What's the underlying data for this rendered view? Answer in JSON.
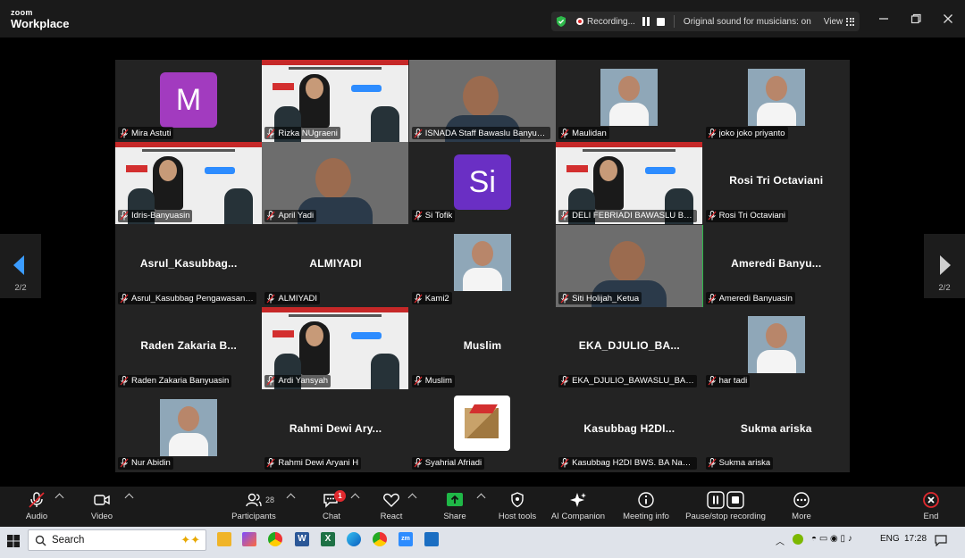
{
  "app": {
    "logo_line1": "zoom",
    "logo_line2": "Workplace"
  },
  "recording": {
    "status": "Recording...",
    "original_sound": "Original sound for musicians: on",
    "view_label": "View"
  },
  "participants": [
    {
      "label": "Mira Astuti",
      "type": "avatar",
      "initial": "M",
      "color": "#a23bbf"
    },
    {
      "label": "Rizka NUgraeni",
      "type": "banner"
    },
    {
      "label": "ISNADA Staff Bawaslu Banyua...",
      "type": "video"
    },
    {
      "label": "Maulidan",
      "type": "video"
    },
    {
      "label": "joko joko priyanto",
      "type": "video"
    },
    {
      "label": "Idris-Banyuasin",
      "type": "banner"
    },
    {
      "label": "April Yadi",
      "type": "video"
    },
    {
      "label": "Si Tofik",
      "type": "avatar",
      "initial": "Si",
      "color": "#6a2fc4"
    },
    {
      "label": "DELI FEBRIADI BAWASLU BAN...",
      "type": "banner"
    },
    {
      "label": "Rosi Tri Octaviani",
      "type": "name",
      "display": "Rosi Tri Octaviani"
    },
    {
      "label": "Asrul_Kasubbag Pengawasan ...",
      "type": "name",
      "display": "Asrul_Kasubbag..."
    },
    {
      "label": "ALMIYADI",
      "type": "name",
      "display": "ALMIYADI"
    },
    {
      "label": "Kami2",
      "type": "video"
    },
    {
      "label": "Siti Holijah_Ketua",
      "type": "video",
      "active": true
    },
    {
      "label": "Ameredi Banyuasin",
      "type": "name",
      "display": "Ameredi  Banyu..."
    },
    {
      "label": "Raden Zakaria Banyuasin",
      "type": "name",
      "display": "Raden  Zakaria  B..."
    },
    {
      "label": "Ardi Yansyah",
      "type": "banner"
    },
    {
      "label": "Muslim",
      "type": "name",
      "display": "Muslim"
    },
    {
      "label": "EKA_DJULIO_BAWASLU_BANY...",
      "type": "name",
      "display": "EKA_DJULIO_BA..."
    },
    {
      "label": "har tadi",
      "type": "video"
    },
    {
      "label": "Nur Abidin",
      "type": "video"
    },
    {
      "label": "Rahmi Dewi Aryani H",
      "type": "name",
      "display": "Rahmi  Dewi  Ary..."
    },
    {
      "label": "Syahrial Afriadi",
      "type": "logo"
    },
    {
      "label": "Kasubbag H2DI BWS. BA Nazi...",
      "type": "name",
      "display": "Kasubbag  H2DI..."
    },
    {
      "label": "Sukma ariska",
      "type": "name",
      "display": "Sukma ariska"
    }
  ],
  "paging": {
    "left": "2/2",
    "right": "2/2"
  },
  "toolbar": {
    "audio": "Audio",
    "video": "Video",
    "participants": "Participants",
    "participants_count": "28",
    "chat": "Chat",
    "chat_badge": "1",
    "react": "React",
    "share": "Share",
    "host_tools": "Host tools",
    "ai_companion": "AI Companion",
    "meeting_info": "Meeting info",
    "pause_stop": "Pause/stop recording",
    "more": "More",
    "end": "End"
  },
  "taskbar": {
    "search_placeholder": "Search",
    "lang": "ENG",
    "time": "17:28"
  }
}
